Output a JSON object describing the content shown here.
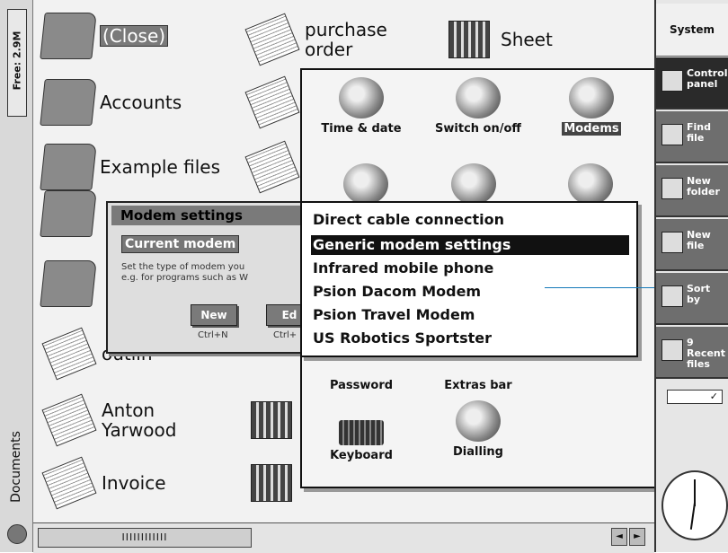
{
  "left_strip": {
    "free": "Free: 2.9M",
    "app": "Documents"
  },
  "items": [
    {
      "label": "(Close)",
      "icon": "folder-open-icon"
    },
    {
      "label": "Accounts",
      "icon": "folder-icon"
    },
    {
      "label": "Example files",
      "icon": "folder-icon"
    },
    {
      "label": "Anton\nYarwood",
      "icon": "document-icon"
    },
    {
      "label": "Invoice",
      "icon": "document-icon"
    },
    {
      "label": "purchase\norder",
      "icon": "document-icon"
    },
    {
      "label": "Sheet",
      "icon": "spreadsheet-icon"
    }
  ],
  "partial_labels": {
    "outlin": "outlin",
    "e_right": "e"
  },
  "control_panel": {
    "items": [
      "Time & date",
      "Switch on/off",
      "Modems",
      "Password",
      "Extras bar",
      "Keyboard",
      "Dialling"
    ],
    "selected": "Modems"
  },
  "dialog": {
    "title": "Modem settings",
    "current_modem_label": "Current modem",
    "description": "Set the type of modem you\ne.g. for programs such as W",
    "new_button": "New",
    "new_hotkey": "Ctrl+N",
    "edit_button": "Ed",
    "edit_hotkey": "Ctrl+"
  },
  "modem_list": {
    "options": [
      "Direct cable connection",
      "Generic modem settings",
      "Infrared mobile phone",
      "Psion Dacom Modem",
      "Psion Travel Modem",
      "US Robotics Sportster"
    ],
    "selected": "Generic modem settings"
  },
  "bottom_bar": {
    "ticks": "IIIIIIIIIIII",
    "left_arrow": "◄",
    "right_arrow": "►"
  },
  "sidebar": {
    "title": "System",
    "buttons": [
      {
        "label": "Control\npanel",
        "icon": "control-panel-icon"
      },
      {
        "label": "Find\nfile",
        "icon": "find-file-icon"
      },
      {
        "label": "New\nfolder",
        "icon": "new-folder-icon"
      },
      {
        "label": "New\nfile",
        "icon": "new-file-icon"
      },
      {
        "label": "Sort\nby",
        "icon": "sort-icon"
      },
      {
        "label": "9 Recent\nfiles",
        "icon": "recent-files-icon"
      }
    ],
    "slider_symbol": "✓"
  }
}
